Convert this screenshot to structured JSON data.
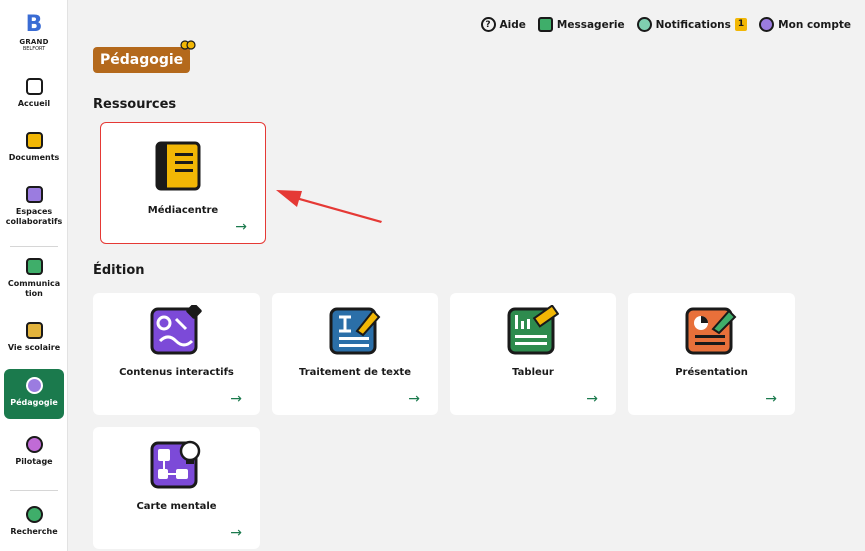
{
  "sidebar": {
    "logo": {
      "line1": "GRAND",
      "line2": "BELFORT"
    },
    "items": [
      {
        "label": "Accueil",
        "icon": "home-icon"
      },
      {
        "label": "Documents",
        "icon": "documents-icon"
      },
      {
        "label": "Espaces collaboratifs",
        "icon": "collaborative-spaces-icon"
      },
      {
        "label": "Communica tion",
        "icon": "communication-icon"
      },
      {
        "label": "Vie scolaire",
        "icon": "school-life-icon"
      },
      {
        "label": "Pédagogie",
        "icon": "pedagogy-icon"
      },
      {
        "label": "Pilotage",
        "icon": "steering-icon"
      },
      {
        "label": "Recherche",
        "icon": "search-icon"
      }
    ]
  },
  "topbar": {
    "help": "Aide",
    "messaging": "Messagerie",
    "notifications": "Notifications",
    "notifications_count": "1",
    "account": "Mon compte"
  },
  "page": {
    "title": "Pédagogie"
  },
  "sections": {
    "resources": {
      "title": "Ressources",
      "cards": [
        {
          "label": "Médiacentre",
          "icon": "mediacentre-book-icon"
        }
      ]
    },
    "edition": {
      "title": "Édition",
      "cards": [
        {
          "label": "Contenus interactifs",
          "icon": "interactive-content-icon"
        },
        {
          "label": "Traitement de texte",
          "icon": "word-processing-icon"
        },
        {
          "label": "Tableur",
          "icon": "spreadsheet-icon"
        },
        {
          "label": "Présentation",
          "icon": "presentation-icon"
        },
        {
          "label": "Carte mentale",
          "icon": "mind-map-icon"
        }
      ]
    }
  },
  "arrow_glyph": "→",
  "colors": {
    "active_nav": "#1b7a4d",
    "title_badge": "#b4691c",
    "highlight": "#e53935",
    "card_arrow": "#1b7a4d",
    "mediacentre": "#f2b705",
    "interactive": "#7c4ad8",
    "word": "#2b6fa8",
    "spreadsheet": "#2e8b4e",
    "presentation": "#e8703a",
    "mindmap": "#7c4ad8"
  }
}
